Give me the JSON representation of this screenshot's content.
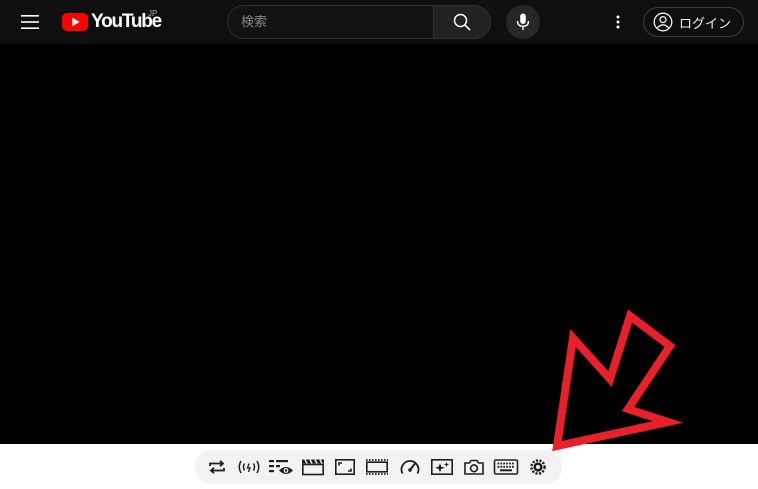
{
  "header": {
    "logo": {
      "text": "YouTube",
      "region": "JP"
    },
    "search": {
      "placeholder": "検索",
      "value": ""
    },
    "login_label": "ログイン"
  },
  "toolbar": {
    "buttons": [
      {
        "name": "loop-button",
        "icon": "repeat-icon"
      },
      {
        "name": "broadcast-button",
        "icon": "broadcast-icon"
      },
      {
        "name": "watch-later-button",
        "icon": "playlist-eye-icon"
      },
      {
        "name": "cinema-button",
        "icon": "clapperboard-icon"
      },
      {
        "name": "resize-button",
        "icon": "expand-corners-icon"
      },
      {
        "name": "theater-button",
        "icon": "film-strip-icon"
      },
      {
        "name": "speed-button",
        "icon": "speedometer-icon"
      },
      {
        "name": "filter-button",
        "icon": "sparkle-icon"
      },
      {
        "name": "screenshot-button",
        "icon": "camera-icon"
      },
      {
        "name": "keyboard-button",
        "icon": "keyboard-icon"
      },
      {
        "name": "settings-button",
        "icon": "gear-icon"
      }
    ]
  },
  "annotation": {
    "arrow_color": "#e8202a"
  },
  "colors": {
    "brand_red": "#ff0000",
    "header_bg": "#0f0f0f",
    "player_bg": "#000000",
    "toolbar_bg": "#f2f2f2",
    "icon_color": "#1f1f1f"
  }
}
